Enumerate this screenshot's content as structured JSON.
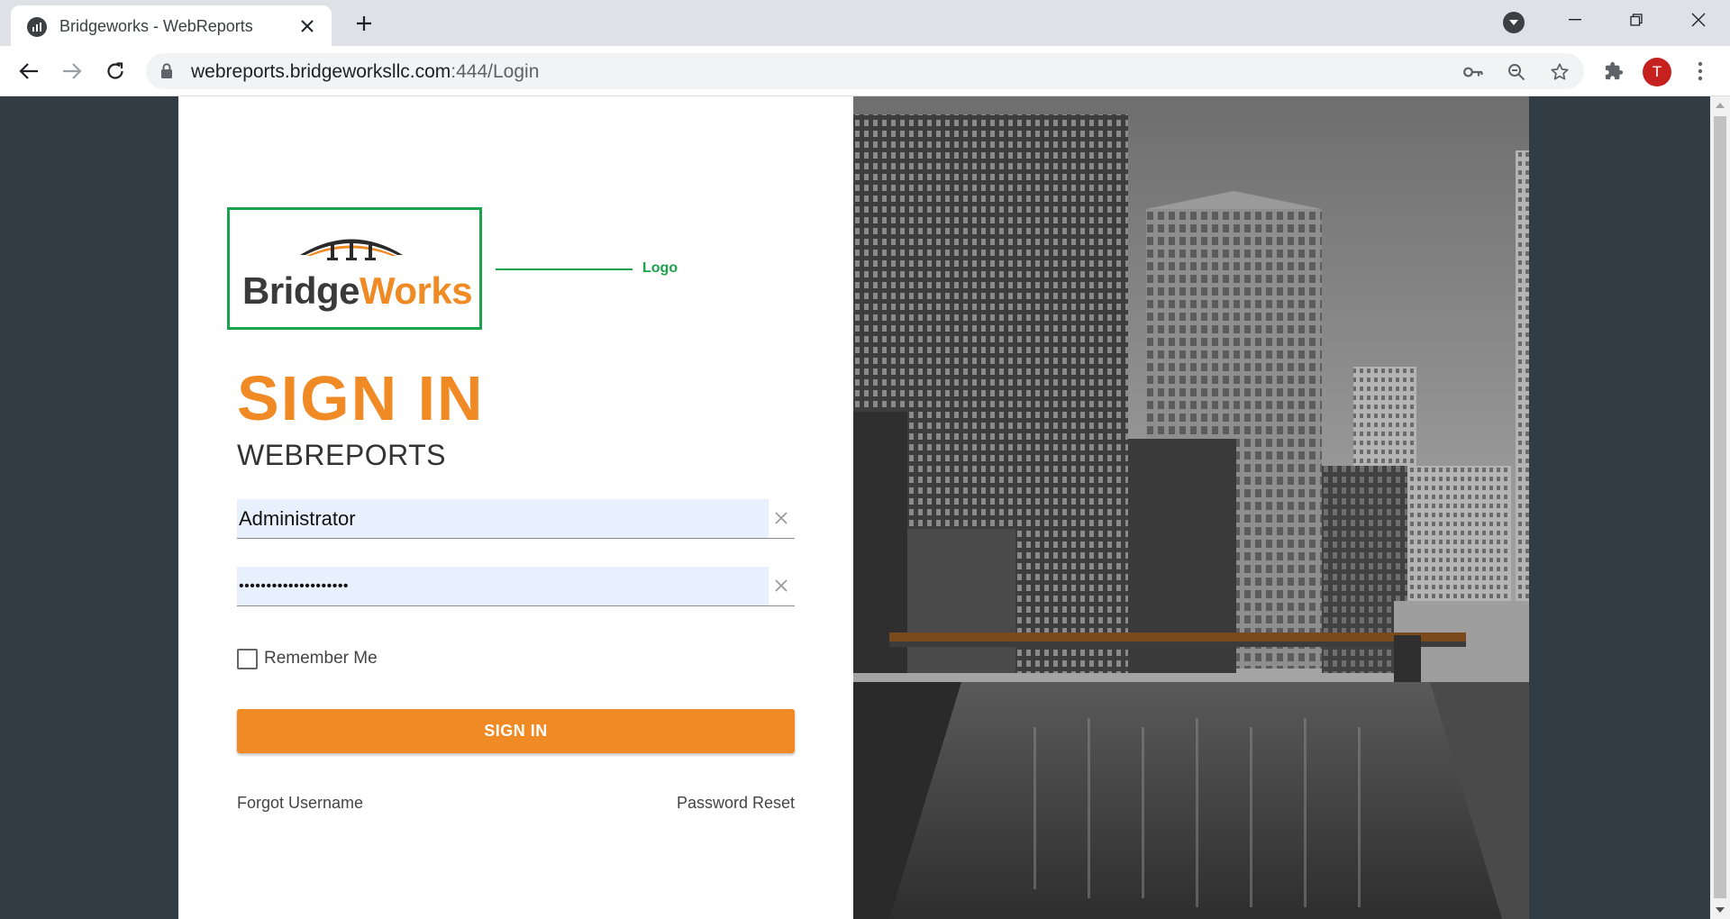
{
  "browser": {
    "tab_title": "Bridgeworks - WebReports",
    "url_host": "webreports.bridgeworksllc.com",
    "url_path": ":444/Login",
    "profile_initial": "T"
  },
  "login": {
    "logo_text_dark": "Bridge",
    "logo_text_accent": "Works",
    "logo_callout": "Logo",
    "title": "SIGN IN",
    "subtitle": "WEBREPORTS",
    "username_value": "Administrator",
    "password_value": "••••••••••••••••••••",
    "remember_label": "Remember Me",
    "remember_checked": false,
    "sign_in_button": "SIGN IN",
    "forgot_username": "Forgot Username",
    "password_reset": "Password Reset"
  },
  "colors": {
    "accent": "#f08a24",
    "callout": "#1aa34a",
    "page_background": "#323c45",
    "autofill": "#e8f0fe"
  }
}
